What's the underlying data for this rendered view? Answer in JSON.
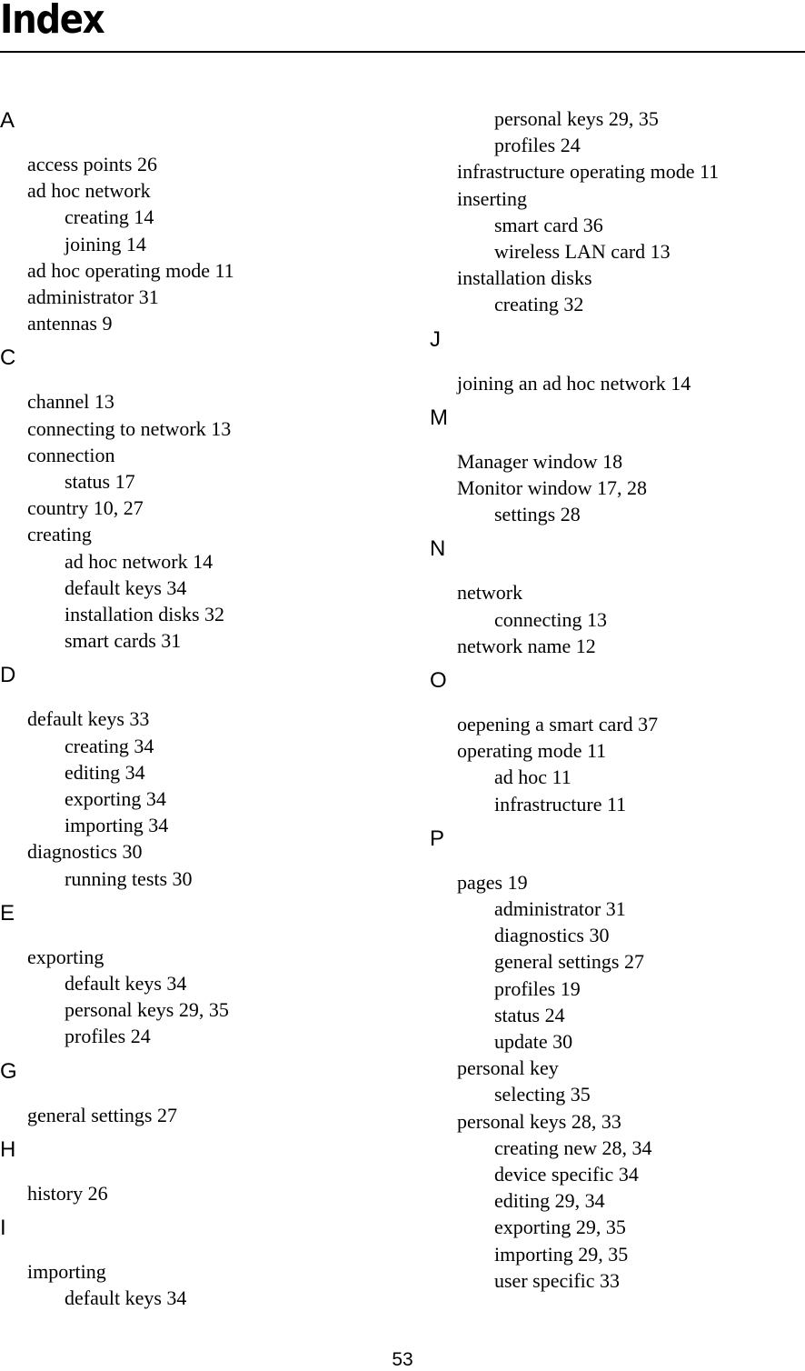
{
  "title": "Index",
  "page_number": "53",
  "columns": [
    {
      "lines": [
        {
          "type": "letter",
          "text": "A"
        },
        {
          "type": "lv1",
          "text": "access points 26"
        },
        {
          "type": "lv1",
          "text": "ad hoc network"
        },
        {
          "type": "lv2",
          "text": "creating 14"
        },
        {
          "type": "lv2",
          "text": "joining 14"
        },
        {
          "type": "lv1",
          "text": "ad hoc operating mode 11"
        },
        {
          "type": "lv1",
          "text": "administrator 31"
        },
        {
          "type": "lv1",
          "text": "antennas 9"
        },
        {
          "type": "letter",
          "text": "C"
        },
        {
          "type": "lv1",
          "text": "channel 13"
        },
        {
          "type": "lv1",
          "text": "connecting to network 13"
        },
        {
          "type": "lv1",
          "text": "connection"
        },
        {
          "type": "lv2",
          "text": "status 17"
        },
        {
          "type": "lv1",
          "text": "country 10, 27"
        },
        {
          "type": "lv1",
          "text": "creating"
        },
        {
          "type": "lv2",
          "text": "ad hoc network 14"
        },
        {
          "type": "lv2",
          "text": "default keys 34"
        },
        {
          "type": "lv2",
          "text": "installation disks 32"
        },
        {
          "type": "lv2",
          "text": "smart cards 31"
        },
        {
          "type": "letter",
          "text": "D"
        },
        {
          "type": "lv1",
          "text": "default keys 33"
        },
        {
          "type": "lv2",
          "text": "creating 34"
        },
        {
          "type": "lv2",
          "text": "editing 34"
        },
        {
          "type": "lv2",
          "text": "exporting 34"
        },
        {
          "type": "lv2",
          "text": "importing 34"
        },
        {
          "type": "lv1",
          "text": "diagnostics 30"
        },
        {
          "type": "lv2",
          "text": "running tests 30"
        },
        {
          "type": "letter",
          "text": "E"
        },
        {
          "type": "lv1",
          "text": "exporting"
        },
        {
          "type": "lv2",
          "text": "default keys 34"
        },
        {
          "type": "lv2",
          "text": "personal keys 29, 35"
        },
        {
          "type": "lv2",
          "text": "profiles 24"
        },
        {
          "type": "letter",
          "text": "G"
        },
        {
          "type": "lv1",
          "text": "general settings 27"
        },
        {
          "type": "letter",
          "text": "H"
        },
        {
          "type": "lv1",
          "text": "history 26"
        },
        {
          "type": "letter",
          "text": "I"
        },
        {
          "type": "lv1",
          "text": "importing"
        },
        {
          "type": "lv2",
          "text": "default keys 34"
        }
      ]
    },
    {
      "lines": [
        {
          "type": "lv2",
          "text": "personal keys 29, 35"
        },
        {
          "type": "lv2",
          "text": "profiles 24"
        },
        {
          "type": "lv1",
          "text": "infrastructure operating mode 11"
        },
        {
          "type": "lv1",
          "text": "inserting"
        },
        {
          "type": "lv2",
          "text": "smart card 36"
        },
        {
          "type": "lv2",
          "text": "wireless LAN card 13"
        },
        {
          "type": "lv1",
          "text": "installation disks"
        },
        {
          "type": "lv2",
          "text": "creating 32"
        },
        {
          "type": "letter",
          "text": "J"
        },
        {
          "type": "lv1",
          "text": "joining an ad hoc network 14"
        },
        {
          "type": "letter",
          "text": "M"
        },
        {
          "type": "lv1",
          "text": "Manager window 18"
        },
        {
          "type": "lv1",
          "text": "Monitor window 17, 28"
        },
        {
          "type": "lv2",
          "text": "settings 28"
        },
        {
          "type": "letter",
          "text": "N"
        },
        {
          "type": "lv1",
          "text": "network"
        },
        {
          "type": "lv2",
          "text": "connecting 13"
        },
        {
          "type": "lv1",
          "text": "network name 12"
        },
        {
          "type": "letter",
          "text": "O"
        },
        {
          "type": "lv1",
          "text": "oepening a smart card 37"
        },
        {
          "type": "lv1",
          "text": "operating mode 11"
        },
        {
          "type": "lv2",
          "text": "ad hoc 11"
        },
        {
          "type": "lv2",
          "text": "infrastructure 11"
        },
        {
          "type": "letter",
          "text": "P"
        },
        {
          "type": "lv1",
          "text": "pages 19"
        },
        {
          "type": "lv2",
          "text": "administrator 31"
        },
        {
          "type": "lv2",
          "text": "diagnostics 30"
        },
        {
          "type": "lv2",
          "text": "general settings 27"
        },
        {
          "type": "lv2",
          "text": "profiles 19"
        },
        {
          "type": "lv2",
          "text": "status 24"
        },
        {
          "type": "lv2",
          "text": "update 30"
        },
        {
          "type": "lv1",
          "text": "personal key"
        },
        {
          "type": "lv2",
          "text": "selecting 35"
        },
        {
          "type": "lv1",
          "text": "personal keys 28, 33"
        },
        {
          "type": "lv2",
          "text": "creating new 28, 34"
        },
        {
          "type": "lv2",
          "text": "device specific 34"
        },
        {
          "type": "lv2",
          "text": "editing 29, 34"
        },
        {
          "type": "lv2",
          "text": "exporting 29, 35"
        },
        {
          "type": "lv2",
          "text": "importing 29, 35"
        },
        {
          "type": "lv2",
          "text": "user specific 33"
        }
      ]
    }
  ]
}
